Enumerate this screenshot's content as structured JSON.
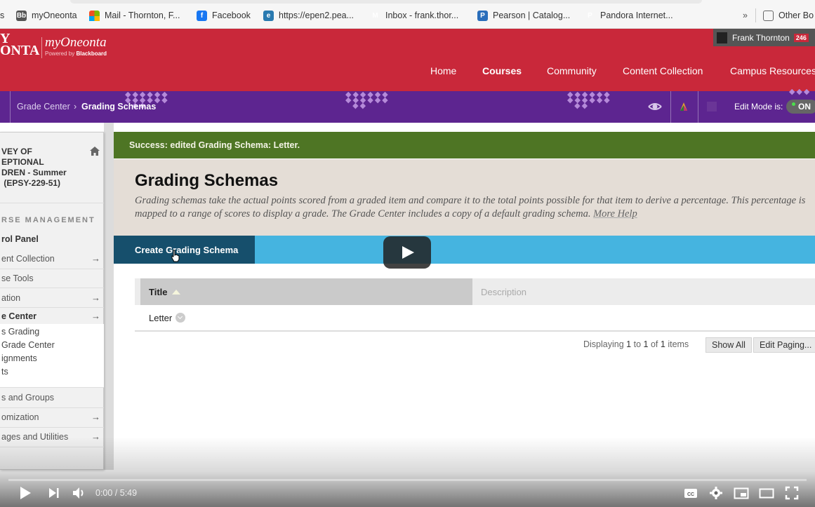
{
  "bookmarks": {
    "items": [
      {
        "label": "s",
        "icon": "none"
      },
      {
        "label": "myOneonta",
        "icon": "blackboard-icon"
      },
      {
        "label": "Mail - Thornton, F...",
        "icon": "microsoft-icon"
      },
      {
        "label": "Facebook",
        "icon": "facebook-icon"
      },
      {
        "label": "https://epen2.pea...",
        "icon": "edge-e-icon"
      },
      {
        "label": "Inbox - frank.thor...",
        "icon": "gmail-icon"
      },
      {
        "label": "Pearson | Catalog...",
        "icon": "pearson-icon"
      },
      {
        "label": "Pandora Internet...",
        "icon": "pandora-icon"
      }
    ],
    "overflow_label": "»",
    "other_label": "Other Bo"
  },
  "header": {
    "logo_left_line1": "Y",
    "logo_left_line2": "ONTA",
    "logo_name": "myOneonta",
    "logo_powered": "Powered by",
    "logo_blackboard": "Blackboard",
    "user_name": "Frank Thornton",
    "user_badge": "246",
    "nav": [
      {
        "label": "Home",
        "active": false
      },
      {
        "label": "Courses",
        "active": true
      },
      {
        "label": "Community",
        "active": false
      },
      {
        "label": "Content Collection",
        "active": false
      },
      {
        "label": "Campus Resources",
        "active": false
      }
    ]
  },
  "breadcrumb": {
    "items": [
      "Grade Center",
      "Grading Schemas"
    ],
    "separator": "›"
  },
  "edit_mode": {
    "label": "Edit Mode is:",
    "state": "ON"
  },
  "sidebar": {
    "course_title": "VEY OF\nEPTIONAL\nDREN - Summer\n (EPSY-229-51)",
    "section_heading": "RSE MANAGEMENT",
    "items": [
      {
        "label": "rol Panel",
        "bold": true,
        "arrow": false
      },
      {
        "label": "ent Collection",
        "bold": false,
        "arrow": true
      },
      {
        "label": "se Tools",
        "bold": false,
        "arrow": false
      },
      {
        "label": "ation",
        "bold": false,
        "arrow": true
      },
      {
        "label": "e Center",
        "bold": true,
        "arrow": true
      },
      {
        "label": "s and Groups",
        "bold": false,
        "arrow": false
      },
      {
        "label": "omization",
        "bold": false,
        "arrow": true
      },
      {
        "label": "ages and Utilities",
        "bold": false,
        "arrow": true
      }
    ],
    "subitems": [
      "s Grading",
      "Grade Center",
      "ignments",
      "ts"
    ],
    "arrow_glyph": "→"
  },
  "success_message": "Success: edited Grading Schema: Letter.",
  "page": {
    "title": "Grading Schemas",
    "description": "Grading schemas take the actual points scored from a graded item and compare it to the total points possible for that item to derive a percentage. This percentage is mapped to a range of scores to display a grade. The Grade Center includes a copy of a default grading schema.",
    "more_help": "More Help"
  },
  "actions": {
    "create_label": "Create Grading Schema"
  },
  "table": {
    "columns": [
      "Title",
      "Description"
    ],
    "rows": [
      {
        "title": "Letter",
        "description": ""
      }
    ]
  },
  "paging": {
    "prefix": "Displaying",
    "from": "1",
    "to_word": "to",
    "to": "1",
    "of_word": "of",
    "total": "1",
    "suffix": "items",
    "show_all": "Show All",
    "edit_paging": "Edit Paging..."
  },
  "video": {
    "current_time": "0:00",
    "duration": "5:49",
    "time_display": "0:00 / 5:49",
    "progress": 0
  }
}
